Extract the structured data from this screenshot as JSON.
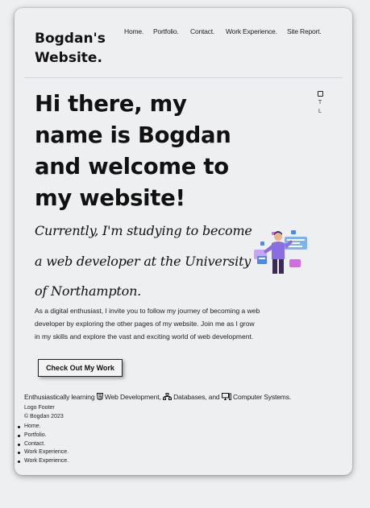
{
  "header": {
    "site_title": "Bogdan's Website.",
    "nav": [
      "Home.",
      "Portfolio.",
      "Contact.",
      "Work Experience.",
      "Site Report."
    ]
  },
  "hero": {
    "headline": "Hi there, my name is Bogdan and welcome to my website!",
    "subheadline": "Currently, I'm studying to become a web developer at the University of Northampton.",
    "paragraph": "As a digital enthusiast, I invite you to follow my journey of becoming a web developer by exploring the other pages of my website. Join me as I grow in my skills and explore the vast and exciting world of web development.",
    "cta_label": "Check Out My Work"
  },
  "side_icons": {
    "icon": "instagram-icon",
    "letters": [
      "T",
      "L"
    ]
  },
  "skills": {
    "prefix": "Enthusiastically learning",
    "items": [
      {
        "icon": "html5-icon",
        "label": "Web Development,"
      },
      {
        "icon": "database-icon",
        "label": "Databases, and"
      },
      {
        "icon": "computer-icon",
        "label": "Computer Systems."
      }
    ]
  },
  "footer": {
    "logo": "Logo Footer",
    "copyright": "© Bogdan 2023",
    "links": [
      "Home.",
      "Portfolio.",
      "Contact.",
      "Work Experience.",
      "Work Experience."
    ]
  },
  "colors": {
    "background": "#eeeff1",
    "text": "#111111",
    "illustration_accent": "#8a6de0",
    "illustration_blue": "#4a8be8"
  }
}
